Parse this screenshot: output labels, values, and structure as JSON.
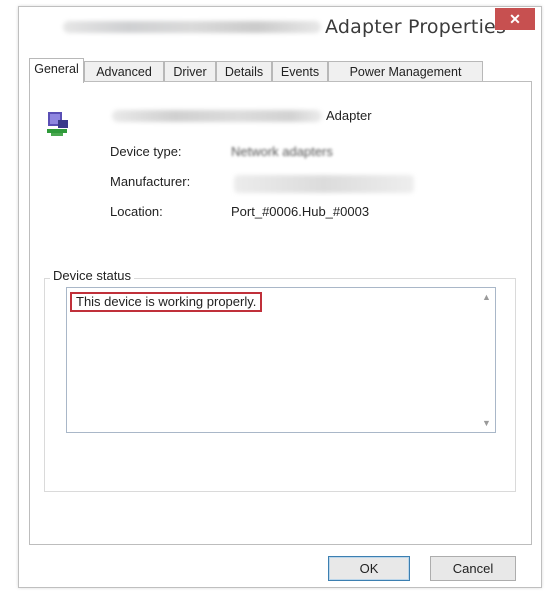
{
  "window": {
    "title": "Adapter Properties",
    "close_label": "✕"
  },
  "tabs": [
    {
      "label": "General",
      "active": true
    },
    {
      "label": "Advanced",
      "active": false
    },
    {
      "label": "Driver",
      "active": false
    },
    {
      "label": "Details",
      "active": false
    },
    {
      "label": "Events",
      "active": false
    },
    {
      "label": "Power Management",
      "active": false
    }
  ],
  "device": {
    "icon": "network-adapter-icon",
    "name_suffix": "Adapter"
  },
  "properties": {
    "device_type_label": "Device type:",
    "device_type_value": "Network adapters",
    "manufacturer_label": "Manufacturer:",
    "location_label": "Location:",
    "location_value": "Port_#0006.Hub_#0003"
  },
  "status": {
    "group_title": "Device status",
    "text": "This device is working properly."
  },
  "buttons": {
    "ok": "OK",
    "cancel": "Cancel"
  },
  "colors": {
    "close_button": "#c75050",
    "highlight_border": "#c0303a",
    "ok_focus_border": "#3c7fb1"
  }
}
